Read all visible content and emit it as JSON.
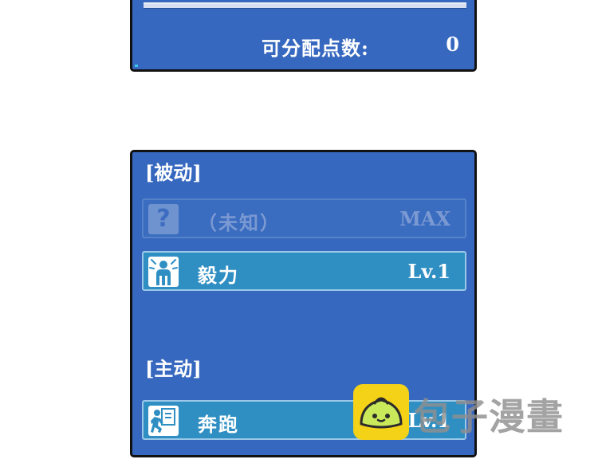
{
  "status_panel": {
    "points_label": "可分配点数:",
    "points_value": "0"
  },
  "skills_panel": {
    "passive_title": "[被动]",
    "active_title": "[主动]",
    "passive": [
      {
        "name": "（未知）",
        "level": "MAX",
        "icon": "question-mark-icon",
        "locked": true
      },
      {
        "name": "毅力",
        "level": "Lv.1",
        "icon": "bracing-figure-icon",
        "locked": false
      }
    ],
    "active": [
      {
        "name": "奔跑",
        "level": "Lv.1",
        "icon": "running-figure-icon",
        "locked": false
      }
    ]
  },
  "watermark": {
    "text": "包子漫畫",
    "logo": "steamed-bun-logo"
  },
  "colors": {
    "panel_blue": "#3668bf",
    "active_row": "#2f8fc3",
    "locked_text": "#7b99d2",
    "logo_yellow": "#f4d218"
  }
}
